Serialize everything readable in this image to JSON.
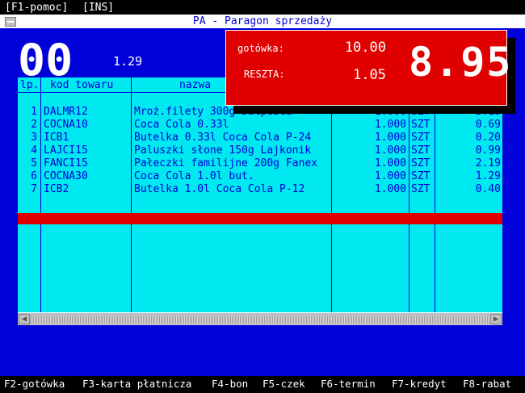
{
  "topbar": {
    "help": "[F1-pomoc]",
    "ins": "[INS]"
  },
  "window": {
    "title": "PA - Paragon sprzedaży"
  },
  "entry": {
    "qty": "00",
    "unit_price": "1.29"
  },
  "payment": {
    "cash_label": "gotówka:",
    "cash_value": "10.00",
    "change_label": "RESZTA:",
    "change_value": "1.05",
    "total": "8.95"
  },
  "table": {
    "headers": {
      "lp": "lp.",
      "code": "kod towaru",
      "name": "nazwa"
    },
    "rows": [
      {
        "lp": "1",
        "code": "DALMR12",
        "name": "Mroż.filety 300g Dalpesca",
        "qty": "1.000",
        "unit": "SZT",
        "price": "3.19"
      },
      {
        "lp": "2",
        "code": "COCNA10",
        "name": "Coca Cola 0.33l",
        "qty": "1.000",
        "unit": "SZT",
        "price": "0.69"
      },
      {
        "lp": "3",
        "code": "ICB1",
        "name": "Butelka 0.33l Coca Cola P-24",
        "qty": "1.000",
        "unit": "SZT",
        "price": "0.20"
      },
      {
        "lp": "4",
        "code": "LAJCI15",
        "name": "Paluszki słone 150g Lajkonik",
        "qty": "1.000",
        "unit": "SZT",
        "price": "0.99"
      },
      {
        "lp": "5",
        "code": "FANCI15",
        "name": "Pałeczki familijne 200g Fanex",
        "qty": "1.000",
        "unit": "SZT",
        "price": "2.19"
      },
      {
        "lp": "6",
        "code": "COCNA30",
        "name": "Coca Cola 1.0l but.",
        "qty": "1.000",
        "unit": "SZT",
        "price": "1.29"
      },
      {
        "lp": "7",
        "code": "ICB2",
        "name": "Butelka 1.0l Coca Cola P-12",
        "qty": "1.000",
        "unit": "SZT",
        "price": "0.40"
      }
    ]
  },
  "fkeys": {
    "f2": "F2-gotówka",
    "f3": "F3-karta płatnicza",
    "f4": "F4-bon",
    "f5": "F5-czek",
    "f6": "F6-termin",
    "f7": "F7-kredyt",
    "f8": "F8-rabat"
  },
  "colors": {
    "window_bg": "#0000d8",
    "grid_bg": "#00e8f0",
    "alert_red": "#e00000"
  }
}
